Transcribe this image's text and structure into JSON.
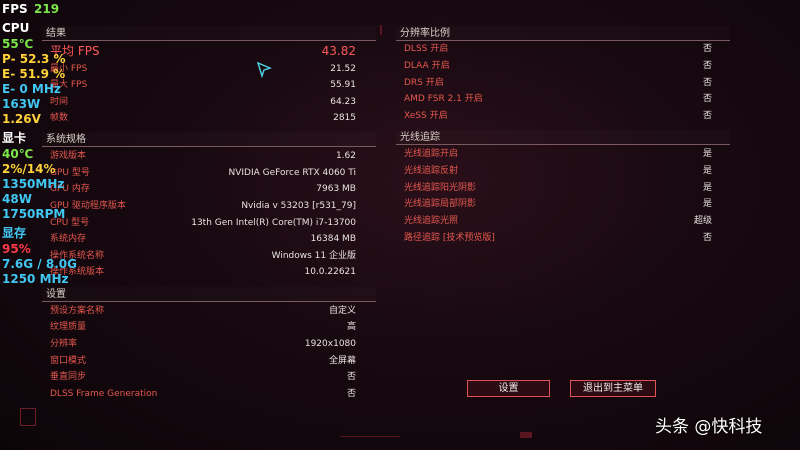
{
  "overlay": {
    "fps_label": "FPS",
    "fps_value": "219",
    "cpu_label": "CPU",
    "cpu_temp": "55℃",
    "cpu_p": "P- 52.3 %",
    "cpu_e": "E- 51.9 %",
    "cpu_e_mhz": "E- 0 MHz",
    "cpu_power": "163W",
    "cpu_voltage": "1.26V",
    "gpu_label": "显卡",
    "gpu_temp": "40℃",
    "gpu_usage": "2%/14%",
    "gpu_clock": "1350MHz",
    "gpu_power": "48W",
    "gpu_fan": "1750RPM",
    "vram_label": "显存",
    "vram_usage": "95%",
    "vram_size": "7.6G / 8.0G",
    "vram_clock": "1250 MHz"
  },
  "results": {
    "title": "结果",
    "avg_label": "平均 FPS",
    "avg_value": "43.82",
    "rows": [
      {
        "label": "最小 FPS",
        "value": "21.52"
      },
      {
        "label": "最大 FPS",
        "value": "55.91"
      },
      {
        "label": "时间",
        "value": "64.23"
      },
      {
        "label": "帧数",
        "value": "2815"
      }
    ]
  },
  "system": {
    "title": "系统规格",
    "rows": [
      {
        "label": "游戏版本",
        "value": "1.62"
      },
      {
        "label": "GPU 型号",
        "value": "NVIDIA GeForce RTX 4060 Ti"
      },
      {
        "label": "GPU 内存",
        "value": "7963 MB"
      },
      {
        "label": "GPU 驱动程序版本",
        "value": "Nvidia v 53203 [r531_79]"
      },
      {
        "label": "CPU 型号",
        "value": "13th Gen Intel(R) Core(TM) i7-13700"
      },
      {
        "label": "系统内存",
        "value": "16384 MB"
      },
      {
        "label": "操作系统名称",
        "value": "Windows 11 企业版"
      },
      {
        "label": "操作系统版本",
        "value": "10.0.22621"
      }
    ]
  },
  "settings": {
    "title": "设置",
    "rows": [
      {
        "label": "预设方案名称",
        "value": "自定义"
      },
      {
        "label": "纹理质量",
        "value": "高"
      },
      {
        "label": "分辨率",
        "value": "1920x1080"
      },
      {
        "label": "窗口模式",
        "value": "全屏幕"
      },
      {
        "label": "垂直同步",
        "value": "否"
      },
      {
        "label": "DLSS Frame Generation",
        "value": "否"
      }
    ]
  },
  "resolution": {
    "title": "分辨率比例",
    "rows": [
      {
        "label": "DLSS 开启",
        "value": "否"
      },
      {
        "label": "DLAA 开启",
        "value": "否"
      },
      {
        "label": "DRS 开启",
        "value": "否"
      },
      {
        "label": "AMD FSR 2.1 开启",
        "value": "否"
      },
      {
        "label": "XeSS 开启",
        "value": "否"
      }
    ]
  },
  "raytracing": {
    "title": "光线追踪",
    "rows": [
      {
        "label": "光线追踪开启",
        "value": "是"
      },
      {
        "label": "光线追踪反射",
        "value": "是"
      },
      {
        "label": "光线追踪阳光阴影",
        "value": "是"
      },
      {
        "label": "光线追踪局部阴影",
        "value": "是"
      },
      {
        "label": "光线追踪光照",
        "value": "超级"
      },
      {
        "label": "路径追踪 [技术预览版]",
        "value": "否"
      }
    ]
  },
  "buttons": {
    "settings": "设置",
    "exit": "退出到主菜单"
  },
  "watermark": "头条 @快科技",
  "colors": {
    "label_red": "#e5584f",
    "accent_red": "#e0525a",
    "overlay_green": "#7de84a",
    "overlay_yellow": "#ffd23a",
    "overlay_cyan": "#41c7f2"
  }
}
